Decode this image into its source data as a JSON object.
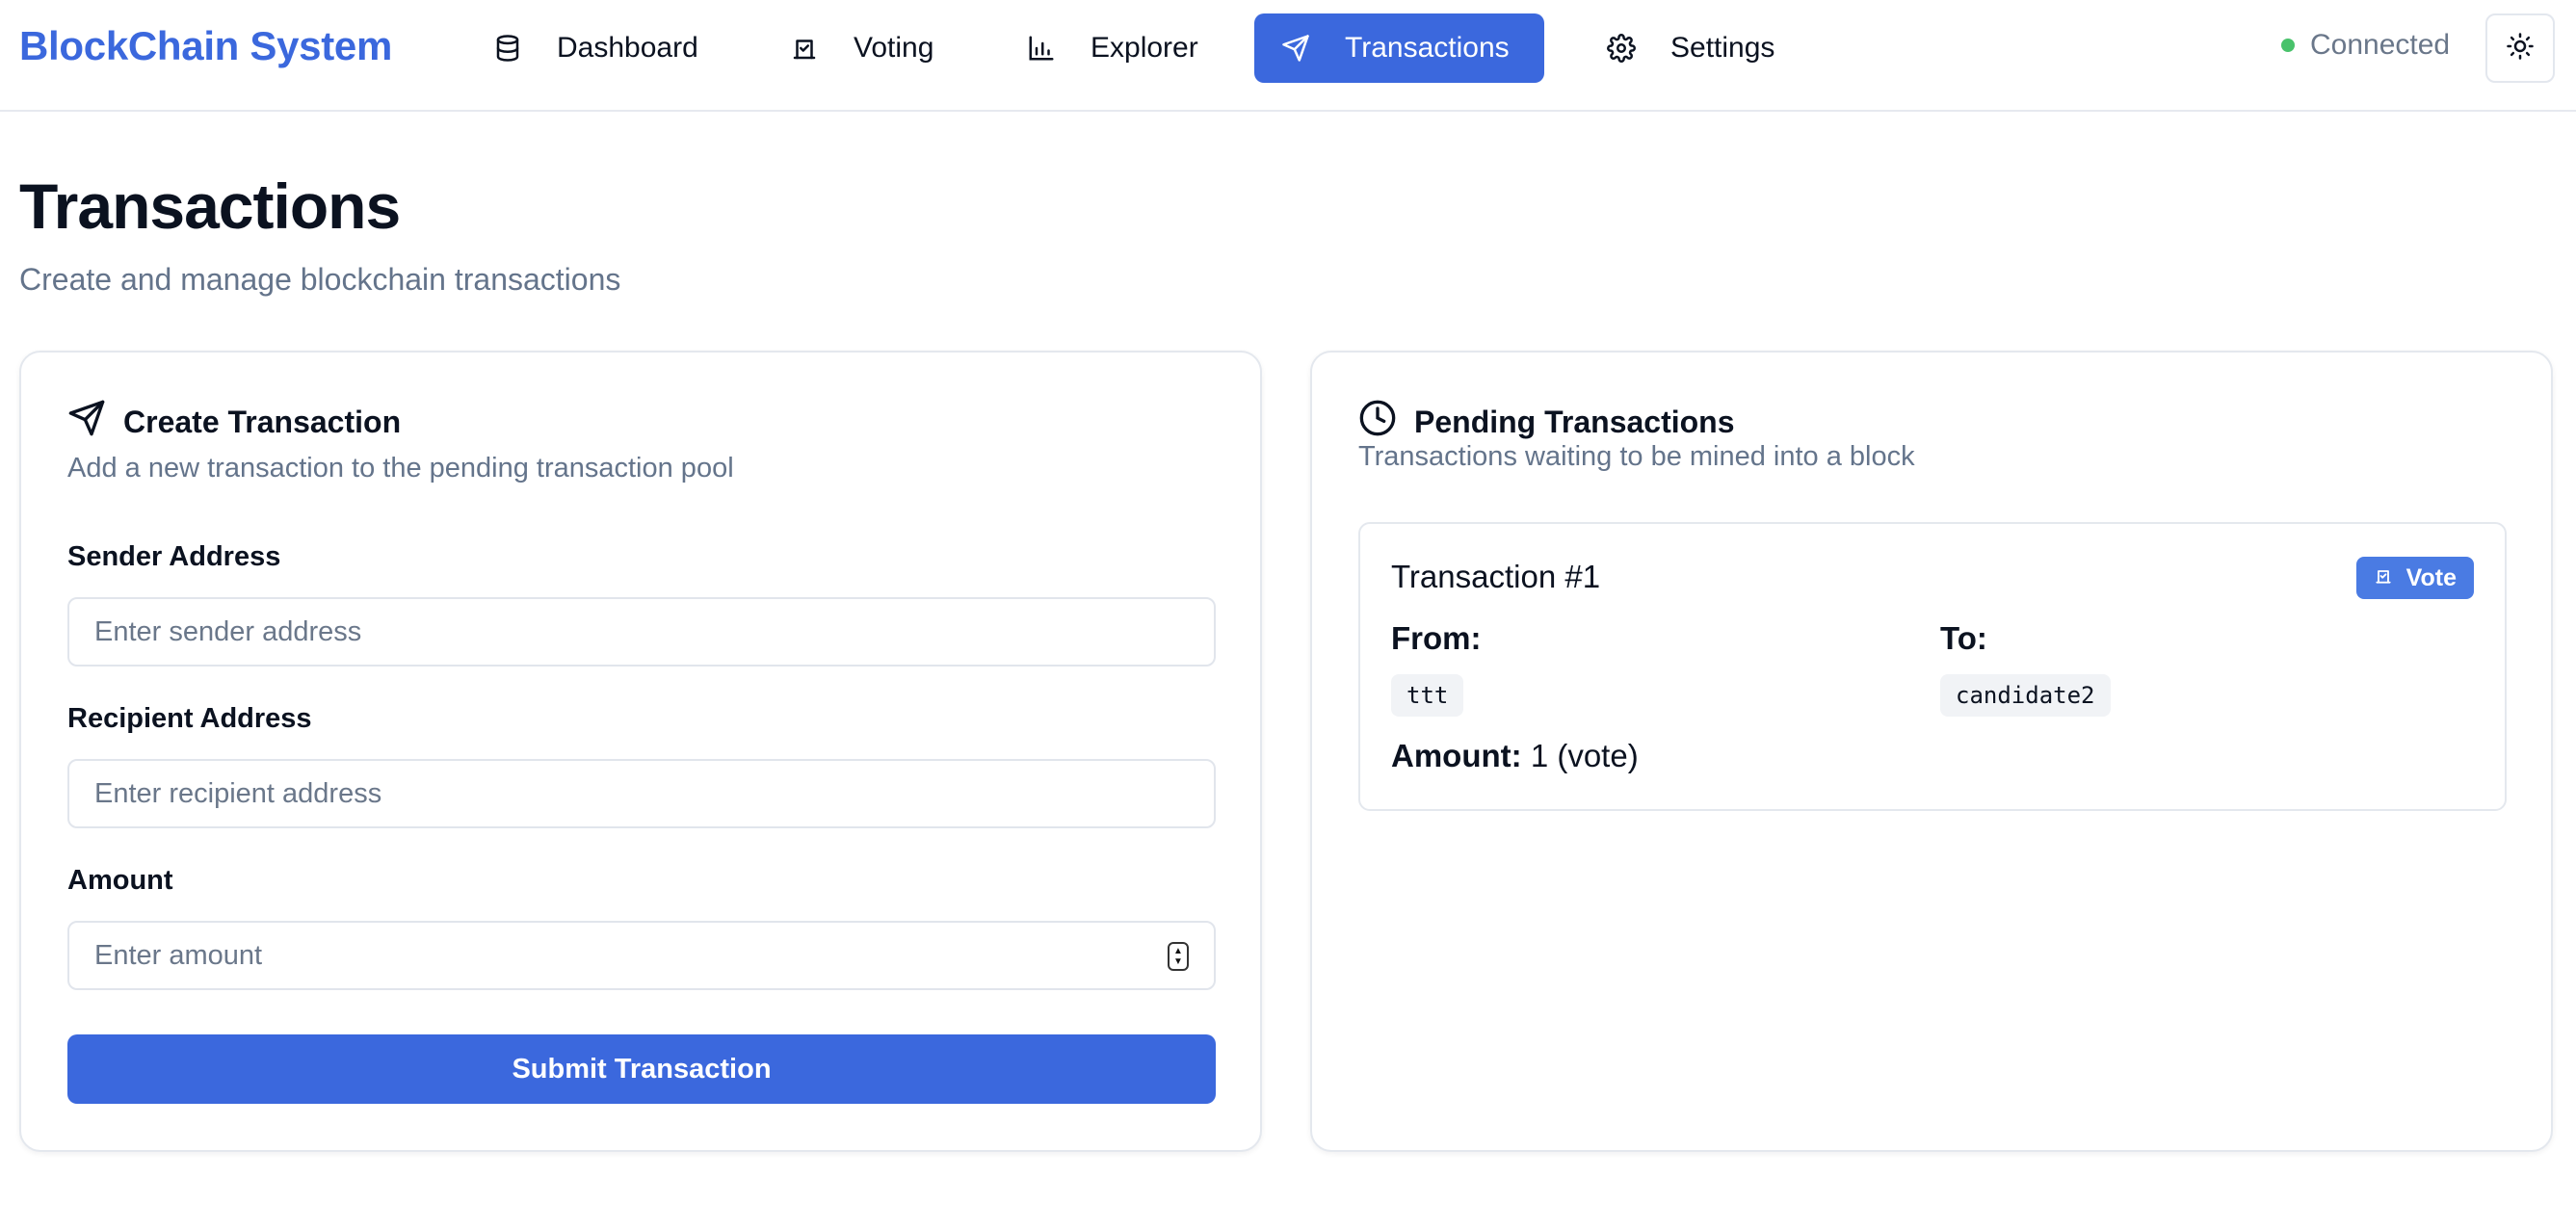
{
  "brand": "BlockChain System",
  "nav": {
    "dashboard": "Dashboard",
    "voting": "Voting",
    "explorer": "Explorer",
    "transactions": "Transactions",
    "settings": "Settings",
    "active": "transactions"
  },
  "status": {
    "label": "Connected",
    "color": "#49c26b"
  },
  "header": {
    "title": "Transactions",
    "subtitle": "Create and manage blockchain transactions"
  },
  "create": {
    "title": "Create Transaction",
    "description": "Add a new transaction to the pending transaction pool",
    "sender_label": "Sender Address",
    "sender_placeholder": "Enter sender address",
    "recipient_label": "Recipient Address",
    "recipient_placeholder": "Enter recipient address",
    "amount_label": "Amount",
    "amount_placeholder": "Enter amount",
    "submit_label": "Submit Transaction"
  },
  "pending": {
    "title": "Pending Transactions",
    "description": "Transactions waiting to be mined into a block",
    "transactions": [
      {
        "title": "Transaction #1",
        "badge": "Vote",
        "from_label": "From:",
        "from": "ttt",
        "to_label": "To:",
        "to": "candidate2",
        "amount_label": "Amount:",
        "amount": "1 (vote)"
      }
    ]
  },
  "colors": {
    "accent": "#3b68dd",
    "badge": "#4a7be3",
    "muted_text": "#64748b"
  }
}
